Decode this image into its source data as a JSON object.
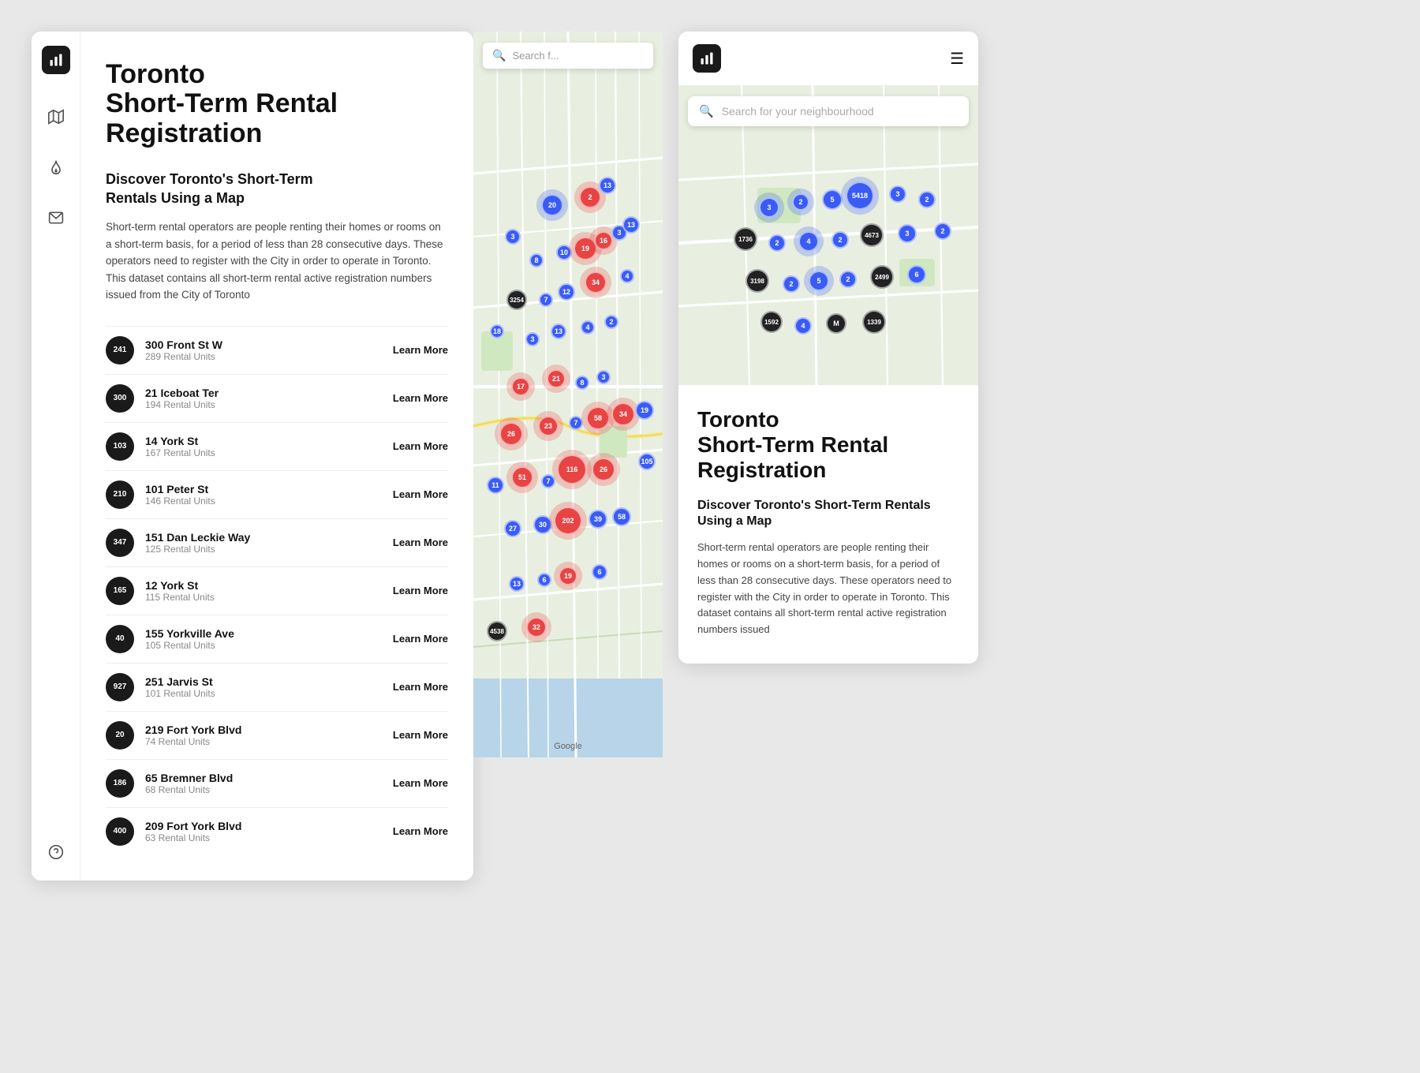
{
  "app": {
    "title": "Toronto\nShort-Term Rental\nRegistration",
    "section_title": "Discover Toronto's Short-Term\nRentals Using a Map",
    "description": "Short-term rental operators are people renting their homes or rooms on a short-term basis, for a period of less than 28 consecutive days. These operators need to register with the City in order to operate in Toronto. This dataset contains all short-term rental active registration numbers issued from the City of Toronto"
  },
  "mobile": {
    "title": "Toronto\nShort-Term Rental\nRegistration",
    "section_title": "Discover Toronto's Short-Term Rentals\nUsing a Map",
    "description": "Short-term rental operators are people renting their homes or rooms on a short-term basis, for a period of less than 28 consecutive days. These operators need to register with the City in order to operate in Toronto. This dataset contains all short-term rental active registration numbers issued",
    "search_placeholder": "Search for your neighbourhood",
    "hamburger": "≡"
  },
  "map": {
    "search_placeholder": "Search f...",
    "google_label": "Google"
  },
  "listings": [
    {
      "badge": "241",
      "name": "300 Front St W",
      "units": "289 Rental Units",
      "learn": "Learn More"
    },
    {
      "badge": "300",
      "name": "21 Iceboat Ter",
      "units": "194 Rental Units",
      "learn": "Learn More"
    },
    {
      "badge": "103",
      "name": "14 York St",
      "units": "167 Rental Units",
      "learn": "Learn More"
    },
    {
      "badge": "210",
      "name": "101 Peter St",
      "units": "146 Rental Units",
      "learn": "Learn More"
    },
    {
      "badge": "347",
      "name": "151 Dan Leckie Way",
      "units": "125 Rental Units",
      "learn": "Learn More"
    },
    {
      "badge": "165",
      "name": "12 York St",
      "units": "115 Rental Units",
      "learn": "Learn More"
    },
    {
      "badge": "40",
      "name": "155 Yorkville Ave",
      "units": "105 Rental Units",
      "learn": "Learn More"
    },
    {
      "badge": "927",
      "name": "251 Jarvis St",
      "units": "101 Rental Units",
      "learn": "Learn More"
    },
    {
      "badge": "20",
      "name": "219 Fort York Blvd",
      "units": "74 Rental Units",
      "learn": "Learn More"
    },
    {
      "badge": "186",
      "name": "65 Bremner Blvd",
      "units": "68 Rental Units",
      "learn": "Learn More"
    },
    {
      "badge": "400",
      "name": "209 Fort York Blvd",
      "units": "63 Rental Units",
      "learn": "Learn More"
    }
  ],
  "sidebar": {
    "icons": [
      "map",
      "fire",
      "mail",
      "help"
    ]
  },
  "colors": {
    "accent": "#1a1a1a",
    "dot_blue": "#3a5cf5",
    "dot_red": "#e84444",
    "dot_dark": "#222222"
  }
}
